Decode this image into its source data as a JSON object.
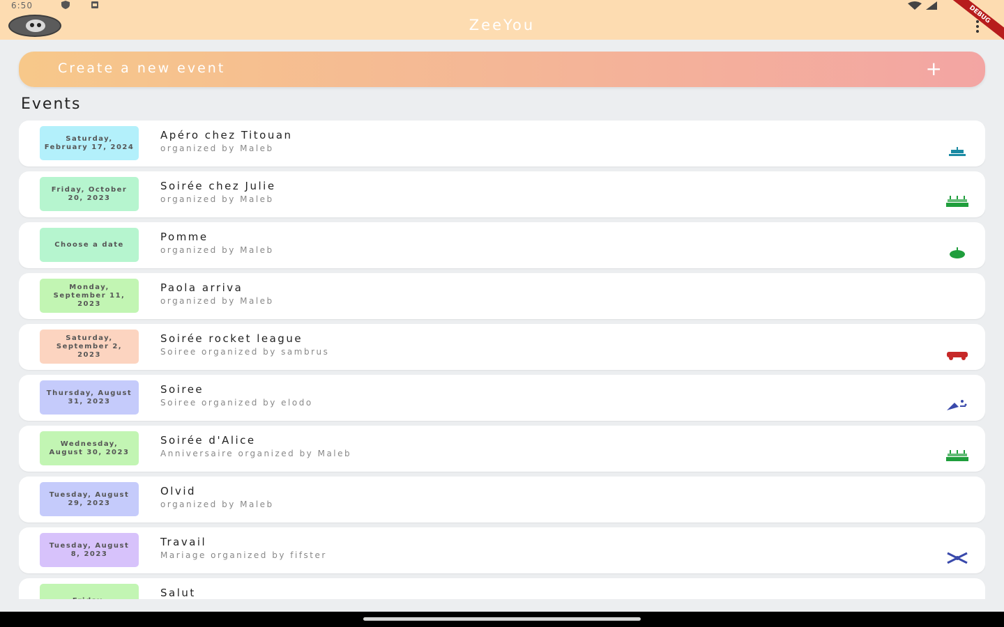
{
  "status": {
    "time": "6:50"
  },
  "app": {
    "title": "ZeeYou",
    "debug_label": "DEBUG"
  },
  "create": {
    "label": "Create a new event",
    "plus": "+"
  },
  "section": {
    "title": "Events"
  },
  "events": [
    {
      "date": "Saturday, February 17, 2024",
      "title": "Apéro chez Titouan",
      "subtitle": " organized by Maleb",
      "color": "#b3f0fb",
      "icon": "cake-icon",
      "icon_color": "#1a8aa3"
    },
    {
      "date": "Friday, October 20, 2023",
      "title": "Soirée chez Julie",
      "subtitle": " organized by Maleb",
      "color": "#b6f5cf",
      "icon": "birthday-cake-icon",
      "icon_color": "#1f9e3c"
    },
    {
      "date": "Choose a date",
      "title": "Pomme",
      "subtitle": " organized by Maleb",
      "color": "#b6f5cf",
      "icon": "apple-icon",
      "icon_color": "#1f9e3c"
    },
    {
      "date": "Monday, September 11, 2023",
      "title": "Paola arriva",
      "subtitle": " organized by Maleb",
      "color": "#c2f5b3",
      "icon": "",
      "icon_color": ""
    },
    {
      "date": "Saturday, September 2, 2023",
      "title": "Soirée rocket league",
      "subtitle": "Soiree organized by sambrus",
      "color": "#fcd4c0",
      "icon": "car-icon",
      "icon_color": "#c62828"
    },
    {
      "date": "Thursday, August 31, 2023",
      "title": "Soiree",
      "subtitle": "Soiree organized by elodo",
      "color": "#c5cbfb",
      "icon": "party-popper-icon",
      "icon_color": "#3949ab"
    },
    {
      "date": "Wednesday, August 30, 2023",
      "title": "Soirée d'Alice",
      "subtitle": "Anniversaire organized by Maleb",
      "color": "#c2f5b3",
      "icon": "birthday-cake-icon",
      "icon_color": "#1f9e3c"
    },
    {
      "date": "Tuesday, August 29, 2023",
      "title": "Olvid",
      "subtitle": " organized by Maleb",
      "color": "#c5cbfb",
      "icon": "",
      "icon_color": ""
    },
    {
      "date": "Tuesday, August 8, 2023",
      "title": "Travail",
      "subtitle": "Mariage organized by fifster",
      "color": "#d7c2fb",
      "icon": "rings-icon",
      "icon_color": "#3949ab"
    },
    {
      "date": "Friday,",
      "title": "Salut",
      "subtitle": "",
      "color": "#c2f5b3",
      "icon": "",
      "icon_color": ""
    }
  ]
}
